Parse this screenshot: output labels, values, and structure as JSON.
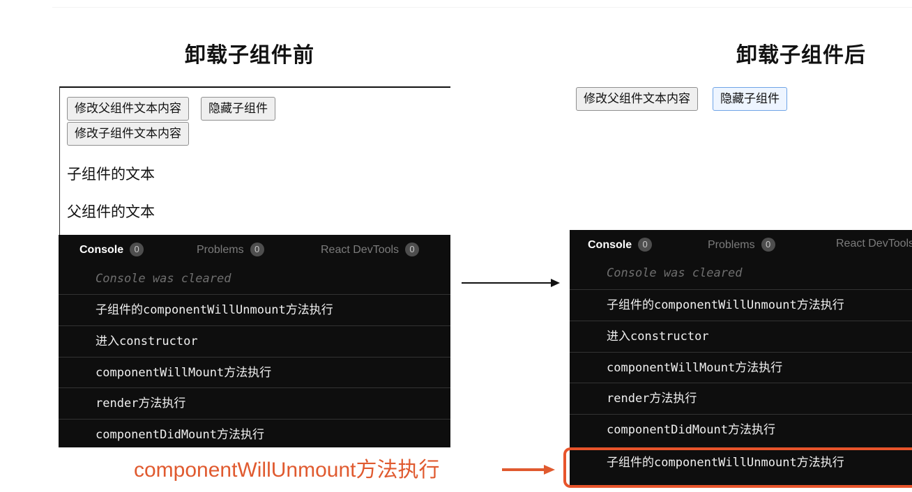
{
  "titles": {
    "before": "卸载子组件前",
    "after": "卸载子组件后"
  },
  "left_view": {
    "buttons": {
      "edit_parent": "修改父组件文本内容",
      "hide_child": "隐藏子组件",
      "edit_child": "修改子组件文本内容"
    },
    "child_text": "子组件的文本",
    "parent_text": "父组件的文本"
  },
  "right_view": {
    "buttons": {
      "edit_parent": "修改父组件文本内容",
      "hide_child": "隐藏子组件"
    }
  },
  "console_left": {
    "tabs": [
      {
        "label": "Console",
        "count": "0"
      },
      {
        "label": "Problems",
        "count": "0"
      },
      {
        "label": "React DevTools",
        "count": "0"
      }
    ],
    "cleared": "Console was cleared",
    "logs": [
      "子组件的componentWillUnmount方法执行",
      "进入constructor",
      "componentWillMount方法执行",
      "render方法执行",
      "componentDidMount方法执行"
    ]
  },
  "console_right": {
    "tabs": [
      {
        "label": "Console",
        "count": "0"
      },
      {
        "label": "Problems",
        "count": "0"
      },
      {
        "label": "React DevTools",
        "count": ""
      }
    ],
    "cleared": "Console was cleared",
    "logs": [
      "子组件的componentWillUnmount方法执行",
      "进入constructor",
      "componentWillMount方法执行",
      "render方法执行",
      "componentDidMount方法执行",
      "子组件的componentWillUnmount方法执行"
    ]
  },
  "annotation": "componentWillUnmount方法执行",
  "colors": {
    "accent": "#e05a2f",
    "console_bg": "#0e0e0e"
  }
}
